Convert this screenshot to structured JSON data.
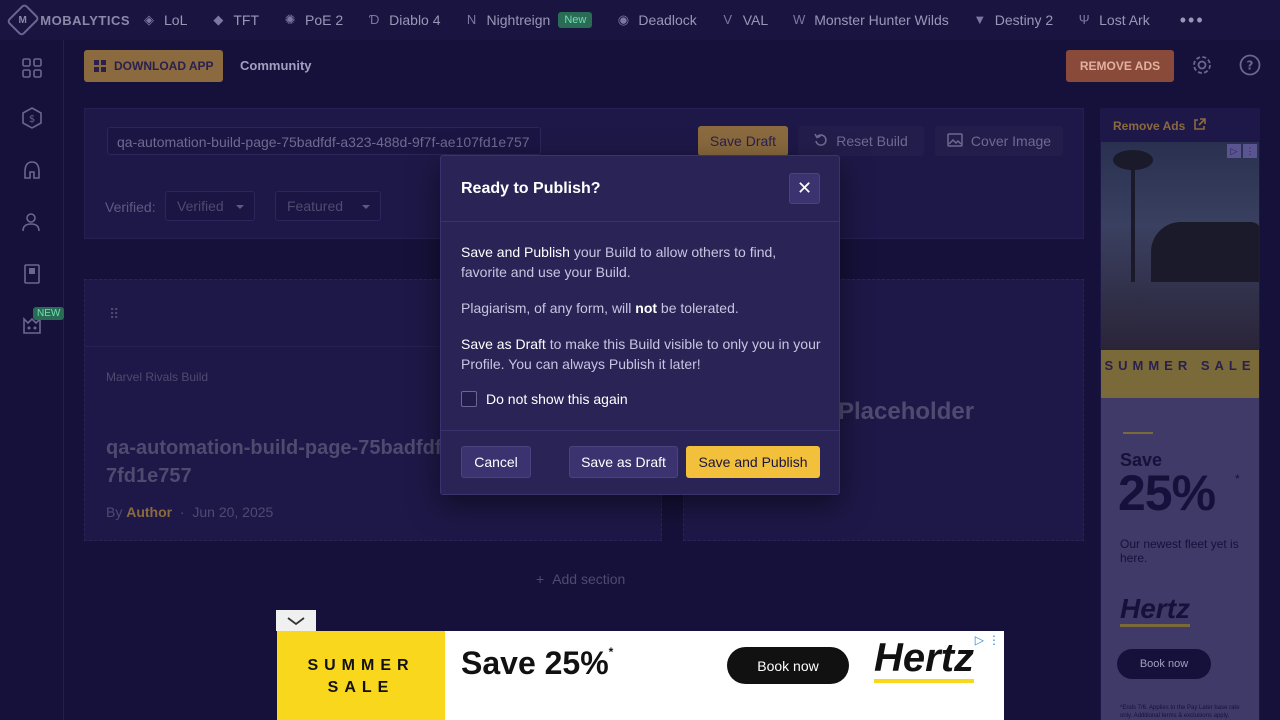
{
  "topnav": {
    "brand": "MOBALYTICS",
    "items": [
      {
        "label": "LoL",
        "icon": "lol-icon"
      },
      {
        "label": "TFT",
        "icon": "tft-icon"
      },
      {
        "label": "PoE 2",
        "icon": "poe2-icon"
      },
      {
        "label": "Diablo 4",
        "icon": "diablo4-icon"
      },
      {
        "label": "Nightreign",
        "icon": "nightreign-icon",
        "badge": "New"
      },
      {
        "label": "Deadlock",
        "icon": "deadlock-icon"
      },
      {
        "label": "VAL",
        "icon": "valorant-icon"
      },
      {
        "label": "Monster Hunter Wilds",
        "icon": "monster-hunter-icon"
      },
      {
        "label": "Destiny 2",
        "icon": "destiny2-icon"
      },
      {
        "label": "Lost Ark",
        "icon": "lost-ark-icon"
      }
    ],
    "more": "•••"
  },
  "sidebar": {
    "new_badge": "NEW"
  },
  "header": {
    "download_label": "DOWNLOAD APP",
    "community_label": "Community",
    "remove_ads_label": "REMOVE ADS"
  },
  "editor": {
    "title_value": "qa-automation-build-page-75badfdf-a323-488d-9f7f-ae107fd1e757",
    "save_draft_label": "Save Draft",
    "reset_label": "Reset Build",
    "cover_label": "Cover Image",
    "verified_label": "Verified:",
    "verified_select": "Verified",
    "featured_select": "Featured"
  },
  "card": {
    "subtitle": "Marvel Rivals Build",
    "title": "qa-automation-build-page-75badfdf-a323-488d-9f7f-ae107fd1e757",
    "by": "By",
    "author": "Author",
    "dot": "·",
    "date": "Jun 20, 2025",
    "placeholder": "Placeholder",
    "add_section": "Add section"
  },
  "right_ad": {
    "remove_ads_link": "Remove Ads",
    "sale": "SUMMER SALE",
    "save": "Save",
    "percent": "25%",
    "asterisk": "*",
    "fleet": "Our newest fleet yet is here.",
    "brand": "Hertz",
    "book": "Book now",
    "fine": "*Ends 7/6. Applies to the Pay Later base rate only. Additional terms & exclusions apply."
  },
  "bottom_ad": {
    "sale": "SUMMER SALE",
    "save": "Save 25%",
    "asterisk": "*",
    "book": "Book now",
    "brand": "Hertz"
  },
  "modal": {
    "title": "Ready to Publish?",
    "close": "✕",
    "p1_strong": "Save and Publish",
    "p1_rest": " your Build to allow others to find, favorite and use your Build.",
    "p2_start": "Plagiarism, of any form, will ",
    "p2_bold": "not",
    "p2_end": " be tolerated.",
    "p3_strong": "Save as Draft",
    "p3_rest": " to make this Build visible to only you in your Profile. You can always Publish it later!",
    "checkbox_label": "Do not show this again",
    "cancel_label": "Cancel",
    "draft_label": "Save as Draft",
    "publish_label": "Save and Publish"
  }
}
